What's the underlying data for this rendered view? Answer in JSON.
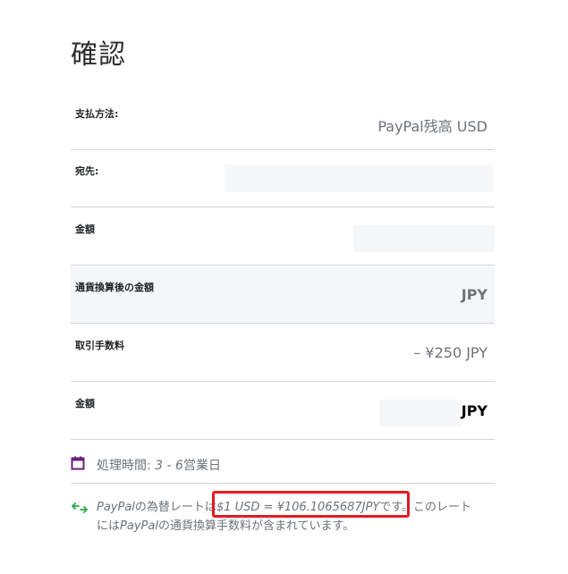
{
  "page": {
    "title": "確認"
  },
  "rows": [
    {
      "label": "支払方法:",
      "value": "PayPal残高 USD"
    },
    {
      "label": "宛先:",
      "value": ""
    },
    {
      "label": "金額",
      "value": ""
    },
    {
      "label": "通貨換算後の金額",
      "value": "JPY"
    },
    {
      "label": "取引手数料",
      "value": "– ¥250 JPY"
    },
    {
      "label": "金額",
      "value": "JPY"
    }
  ],
  "processing": {
    "prefix": "処理時間: ",
    "days": "3 - 6",
    "suffix": "営業日"
  },
  "rate_note": {
    "brand1": "PayPal",
    "text1": "の為替レートは",
    "rate": "$1 USD = ¥106.1065687JPY",
    "text2": "です。このレート",
    "text3": "には",
    "brand2": "PayPal",
    "text4": "の通貨換算手数料が含まれています。"
  },
  "colors": {
    "calendar_icon": "#6b1f7c",
    "exchange_icon": "#2aa84a",
    "highlight": "#e31b23"
  }
}
